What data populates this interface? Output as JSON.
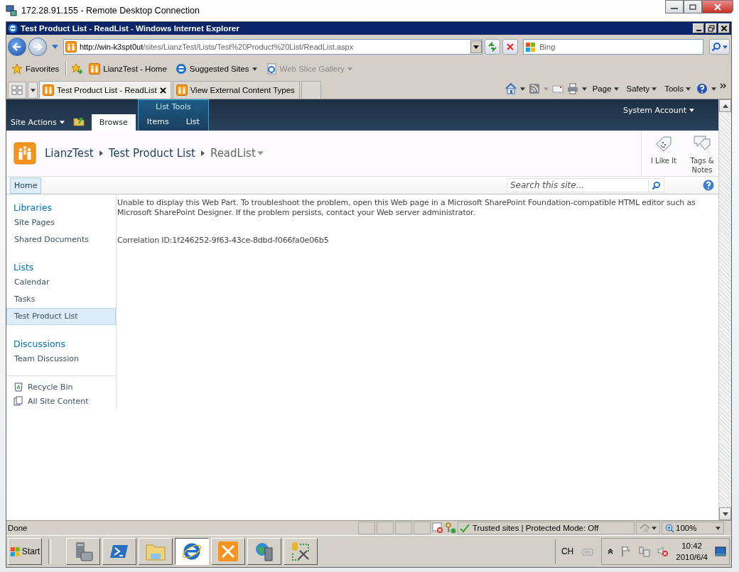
{
  "rdp": {
    "title": "172.28.91.155 - Remote Desktop Connection"
  },
  "ie": {
    "title": "Test Product List - ReadList - Windows Internet Explorer",
    "address_host": "http://win-k3spt0ut",
    "address_path": "/sites/LianzTest/Lists/Test%20Product%20List/ReadList.aspx",
    "search_placeholder": "Bing",
    "favorites_label": "Favorites",
    "favorites": [
      {
        "label": "LianzTest - Home",
        "kind": "site",
        "dropdown": false,
        "disabled": false
      },
      {
        "label": "Suggested Sites",
        "kind": "ie",
        "dropdown": true,
        "disabled": false
      },
      {
        "label": "Web Slice Gallery",
        "kind": "page",
        "dropdown": true,
        "disabled": true
      }
    ],
    "tabs": [
      {
        "label": "Test Product List - ReadList",
        "selected": true
      },
      {
        "label": "View External Content Types",
        "selected": false
      }
    ],
    "commands": [
      "Page",
      "Safety",
      "Tools"
    ]
  },
  "sharepoint": {
    "site_actions": "Site Actions",
    "ribbon_tabs": [
      {
        "label": "Browse",
        "selected": true,
        "contextual": false
      },
      {
        "label": "Items",
        "selected": false,
        "contextual": true
      },
      {
        "label": "List",
        "selected": false,
        "contextual": true
      }
    ],
    "contextual_group": "List Tools",
    "user": "System Account",
    "breadcrumb": [
      "LianzTest",
      "Test Product List",
      "ReadList"
    ],
    "social": [
      {
        "label": "I Like It",
        "kind": "like"
      },
      {
        "label": "Tags & Notes",
        "kind": "tags"
      }
    ],
    "top_nav": [
      {
        "label": "Home",
        "selected": true
      }
    ],
    "search_placeholder": "Search this site...",
    "quick_launch": [
      {
        "heading": "Libraries",
        "items": [
          {
            "label": "Site Pages",
            "selected": false
          },
          {
            "label": "Shared Documents",
            "selected": false
          }
        ]
      },
      {
        "heading": "Lists",
        "items": [
          {
            "label": "Calendar",
            "selected": false
          },
          {
            "label": "Tasks",
            "selected": false
          },
          {
            "label": "Test Product List",
            "selected": true
          }
        ]
      },
      {
        "heading": "Discussions",
        "items": [
          {
            "label": "Team Discussion",
            "selected": false
          }
        ]
      }
    ],
    "bottom_links": [
      {
        "label": "Recycle Bin",
        "kind": "recycle"
      },
      {
        "label": "All Site Content",
        "kind": "content"
      }
    ],
    "message": "Unable to display this Web Part. To troubleshoot the problem, open this Web page in a Microsoft SharePoint Foundation-compatible HTML editor such as Microsoft SharePoint Designer. If the problem persists, contact your Web server administrator.",
    "correlation": "Correlation ID:1f246252-9f63-43ce-8dbd-f066fa0e06b5"
  },
  "status_bar": {
    "text": "Done",
    "zone": "Trusted sites | Protected Mode: Off",
    "zoom": "100%"
  },
  "taskbar": {
    "start": "Start",
    "items": [
      {
        "kind": "server",
        "selected": false
      },
      {
        "kind": "powershell",
        "selected": false
      },
      {
        "kind": "folder",
        "selected": false
      },
      {
        "kind": "ie",
        "selected": true
      },
      {
        "kind": "tools",
        "selected": false
      },
      {
        "kind": "globe",
        "selected": false
      },
      {
        "kind": "dbtools",
        "selected": false
      }
    ],
    "language": "CH",
    "time": "10:42",
    "date": "2010/6/4"
  }
}
